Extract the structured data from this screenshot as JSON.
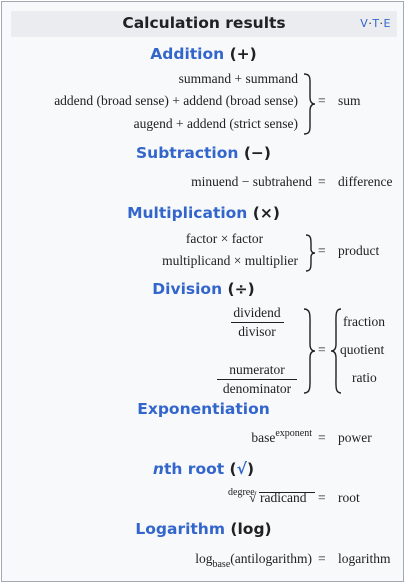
{
  "title": "Calculation results",
  "vte": {
    "v": "V",
    "t": "T",
    "e": "E",
    "sep": "·"
  },
  "symbols": {
    "equals": "=",
    "plus": "+",
    "minus": "−",
    "times": "×",
    "radical": "√"
  },
  "addition": {
    "label": "Addition",
    "symbol": "(+)",
    "lines": [
      [
        "summand",
        "summand"
      ],
      [
        "addend (broad sense)",
        "addend (broad sense)"
      ],
      [
        "augend",
        "addend (strict sense)"
      ]
    ],
    "result": "sum"
  },
  "subtraction": {
    "label": "Subtraction",
    "symbol": "(−)",
    "left": "minuend",
    "right": "subtrahend",
    "result": "difference"
  },
  "multiplication": {
    "label": "Multiplication",
    "symbol": "(×)",
    "lines": [
      [
        "factor",
        "factor"
      ],
      [
        "multiplicand",
        "multiplier"
      ]
    ],
    "result": "product"
  },
  "division": {
    "label": "Division",
    "symbol": "(÷)",
    "fractions": [
      {
        "num": "dividend",
        "den": "divisor"
      },
      {
        "num": "numerator",
        "den": "denominator"
      }
    ],
    "results": [
      "fraction",
      "quotient",
      "ratio"
    ]
  },
  "exponentiation": {
    "label": "Exponentiation",
    "base": "base",
    "exponent": "exponent",
    "result": "power"
  },
  "nth_root": {
    "label_n": "n",
    "label_rest": "th root",
    "symbol": "(√)",
    "degree": "degree",
    "radicand": "radicand",
    "result": "root"
  },
  "logarithm": {
    "label": "Logarithm",
    "symbol": "(log)",
    "log": "log",
    "base": "base",
    "argument": "(antilogarithm)",
    "result": "logarithm"
  }
}
